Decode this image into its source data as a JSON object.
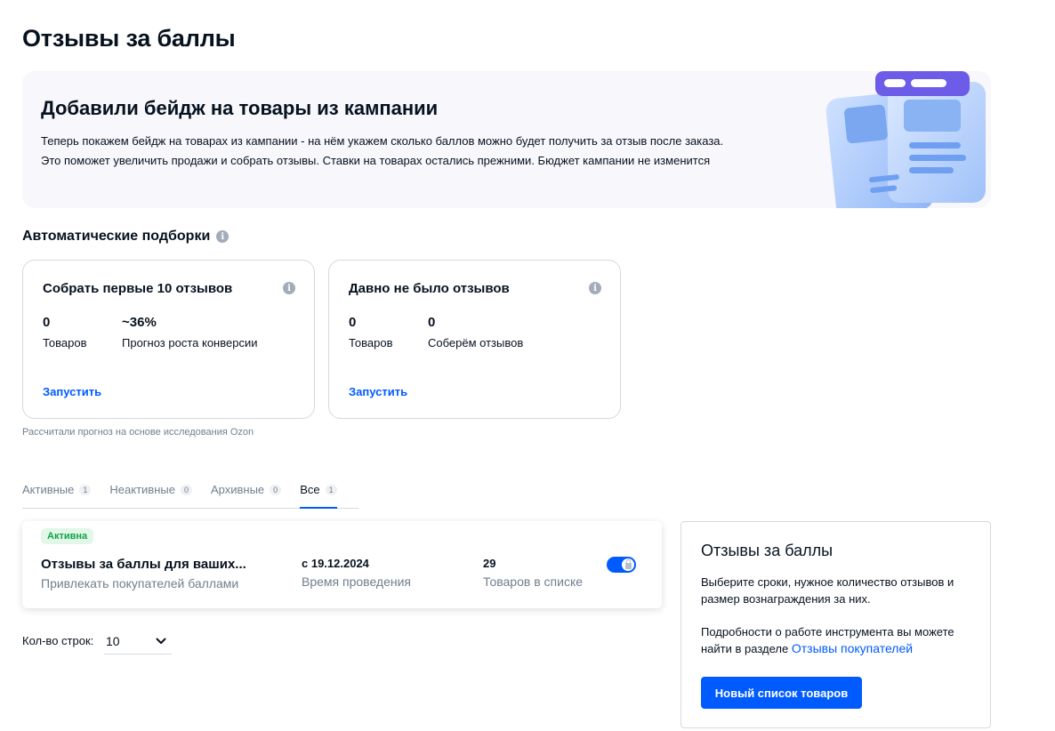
{
  "page": {
    "title": "Отзывы за баллы"
  },
  "banner": {
    "title": "Добавили бейдж на товары из кампании",
    "text": "Теперь покажем бейдж на товарах из кампании - на нём укажем сколько баллов можно будет получить за отзыв после заказа. Это поможет увеличить продажи и собрать отзывы. Ставки на товарах остались прежними. Бюджет кампании не изменится"
  },
  "auto": {
    "title": "Автоматические подборки",
    "cards": [
      {
        "title": "Собрать первые 10 отзывов",
        "stats": [
          {
            "value": "0",
            "label": "Товаров"
          },
          {
            "value": "~36%",
            "label": "Прогноз роста конверсии"
          }
        ],
        "action": "Запустить"
      },
      {
        "title": "Давно не было отзывов",
        "stats": [
          {
            "value": "0",
            "label": "Товаров"
          },
          {
            "value": "0",
            "label": "Соберём отзывов"
          }
        ],
        "action": "Запустить"
      }
    ],
    "footnote": "Рассчитали прогноз на основе исследования Ozon"
  },
  "tabs": [
    {
      "label": "Активные",
      "count": "1"
    },
    {
      "label": "Неактивные",
      "count": "0"
    },
    {
      "label": "Архивные",
      "count": "0"
    },
    {
      "label": "Все",
      "count": "1"
    }
  ],
  "active_tab": "Все",
  "campaign": {
    "status": "Активна",
    "name": "Отзывы за баллы для ваших...",
    "name_sub": "Привлекать покупателей баллами",
    "date": "с 19.12.2024",
    "date_sub": "Время проведения",
    "count": "29",
    "count_sub": "Товаров в списке",
    "enabled": true
  },
  "pagination": {
    "label": "Кол-во строк:",
    "value": "10"
  },
  "side": {
    "title": "Отзывы за баллы",
    "text": "Выберите сроки, нужное количество отзывов и размер вознаграждения за них.",
    "text2": "Подробности о работе инструмента вы можете найти в разделе",
    "link": "Отзывы покупателей",
    "button": "Новый список товаров"
  },
  "colors": {
    "accent": "#005bff",
    "active_badge": "#10a34a",
    "banner_bg": "#f7f7fc"
  }
}
